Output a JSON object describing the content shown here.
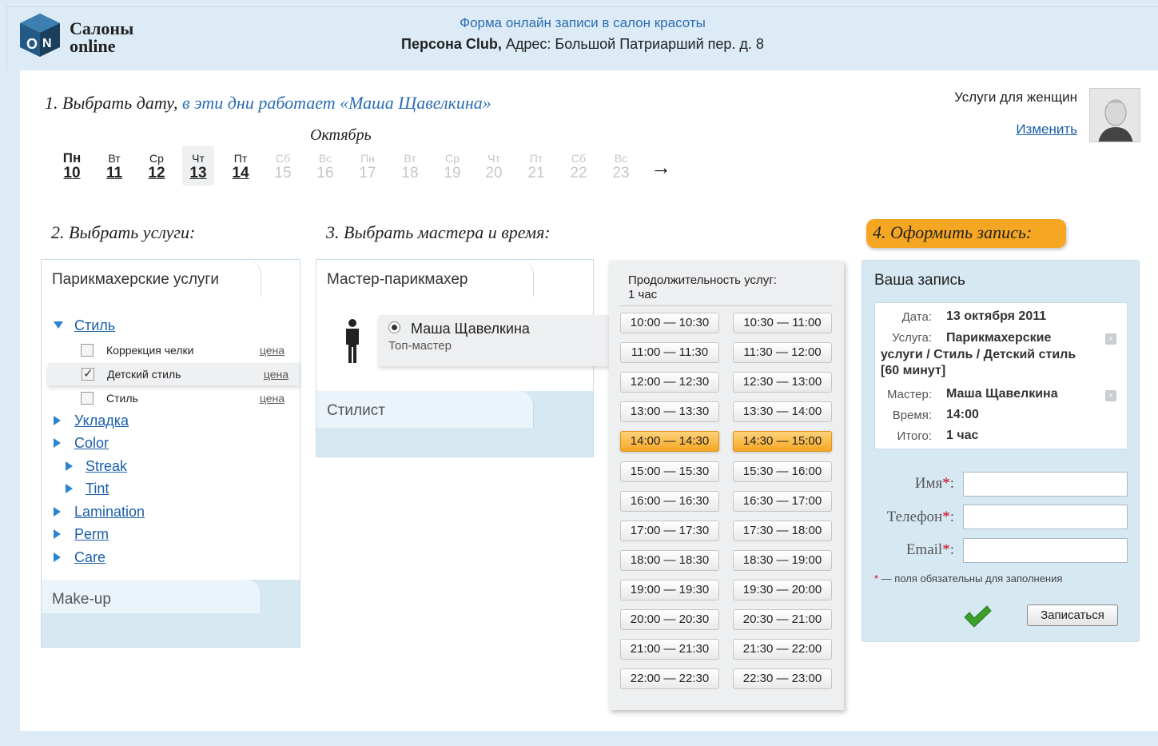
{
  "header": {
    "logo_line1": "Салоны",
    "logo_line2": "online",
    "subtitle": "Форма онлайн записи в салон красоты",
    "salon_name": "Персона Club,",
    "address": " Адрес: Большой Патриарший пер. д. 8"
  },
  "step1": {
    "title": "1. Выбрать дату,",
    "title_suffix": " в эти дни работает «Маша Щавелкина»",
    "month": "Октябрь",
    "days": [
      {
        "dow": "Пн",
        "num": "10"
      },
      {
        "dow": "Вт",
        "num": "11"
      },
      {
        "dow": "Ср",
        "num": "12"
      },
      {
        "dow": "Чт",
        "num": "13"
      },
      {
        "dow": "Пт",
        "num": "14"
      },
      {
        "dow": "Сб",
        "num": "15"
      },
      {
        "dow": "Вс",
        "num": "16"
      },
      {
        "dow": "Пн",
        "num": "17"
      },
      {
        "dow": "Вт",
        "num": "18"
      },
      {
        "dow": "Ср",
        "num": "19"
      },
      {
        "dow": "Чт",
        "num": "20"
      },
      {
        "dow": "Пт",
        "num": "21"
      },
      {
        "dow": "Сб",
        "num": "22"
      },
      {
        "dow": "Вс",
        "num": "23"
      }
    ],
    "next_arrow": "→",
    "selected_day": "13"
  },
  "profile": {
    "category": "Услуги для женщин",
    "change_link": "Изменить"
  },
  "step2": {
    "title": "2. Выбрать услуги:",
    "tab_hair": "Парикмахерские услуги",
    "tab_makeup": "Make-up",
    "group_open": "Стиль",
    "services": [
      {
        "label": "Коррекция челки",
        "price": "цена",
        "checked": false
      },
      {
        "label": "Детский стиль",
        "price": "цена",
        "checked": true
      },
      {
        "label": "Стиль",
        "price": "цена",
        "checked": false
      }
    ],
    "groups": [
      "Укладка",
      "Color",
      "Streak",
      "Tint",
      "Lamination",
      "Perm",
      "Care"
    ]
  },
  "step3": {
    "title": "3. Выбрать мастера и время:",
    "tab_master": "Мастер-парикмахер",
    "tab_stylist": "Стилист",
    "master_name": "Маша Щавелкина",
    "master_title": "Топ-мастер",
    "duration_label": "Продолжительность услуг:",
    "duration_value": "1 час",
    "slots": [
      "10:00 — 10:30",
      "10:30 — 11:00",
      "11:00 — 11:30",
      "11:30 — 12:00",
      "12:00 — 12:30",
      "12:30 — 13:00",
      "13:00 — 13:30",
      "13:30 — 14:00",
      "14:00 — 14:30",
      "14:30 — 15:00",
      "15:00 — 15:30",
      "15:30 — 16:00",
      "16:00 — 16:30",
      "16:30 — 17:00",
      "17:00 — 17:30",
      "17:30 — 18:00",
      "18:00 — 18:30",
      "18:30 — 19:00",
      "19:00 — 19:30",
      "19:30 — 20:00",
      "20:00 — 20:30",
      "20:30 — 21:00",
      "21:00 — 21:30",
      "21:30 — 22:00",
      "22:00 — 22:30",
      "22:30 — 23:00"
    ],
    "selected_slots": [
      "14:00 — 14:30",
      "14:30 — 15:00"
    ]
  },
  "step4": {
    "title": "4. Оформить запись:",
    "box_title": "Ваша запись",
    "date_label": "Дата:",
    "date_value": "13 октября 2011",
    "service_label": "Услуга:",
    "service_value_1": "Парикмахерские",
    "service_value_2": "услуги / Стиль / Детский стиль",
    "service_value_3": "[60 минут]",
    "master_label": "Мастер:",
    "master_value": "Маша Щавелкина",
    "time_label": "Время:",
    "time_value": "14:00",
    "total_label": "Итого:",
    "total_value": "1 час",
    "name_label": "Имя",
    "phone_label": "Телефон",
    "email_label": "Email",
    "required_mark": "*",
    "colon": ":",
    "required_note": " — поля обязательны для заполнения",
    "submit_label": "Записаться",
    "remove_glyph": "×"
  },
  "colors": {
    "accent_blue": "#2a6db3",
    "highlight_orange": "#f5a623",
    "panel_blue": "#d6e9f3"
  }
}
